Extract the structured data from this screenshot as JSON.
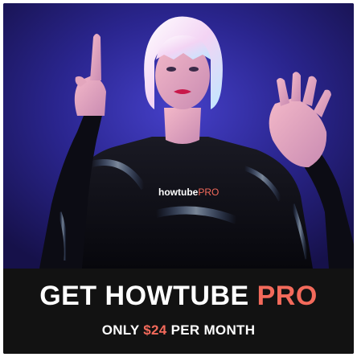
{
  "ad": {
    "shirt_logo": {
      "brand": "howtube",
      "suffix": "PRO"
    },
    "headline": {
      "main": "GET HOWTUBE",
      "accent": "PRO"
    },
    "subline": {
      "prefix": "ONLY",
      "price": "$24",
      "suffix": "PER MONTH"
    },
    "colors": {
      "background_blue": "#2a258e",
      "banner_black": "#121212",
      "accent_coral": "#f36a5b",
      "text_white": "#ffffff",
      "hair_pink": "#f6d7f4",
      "outfit_black": "#0e0e14"
    }
  }
}
